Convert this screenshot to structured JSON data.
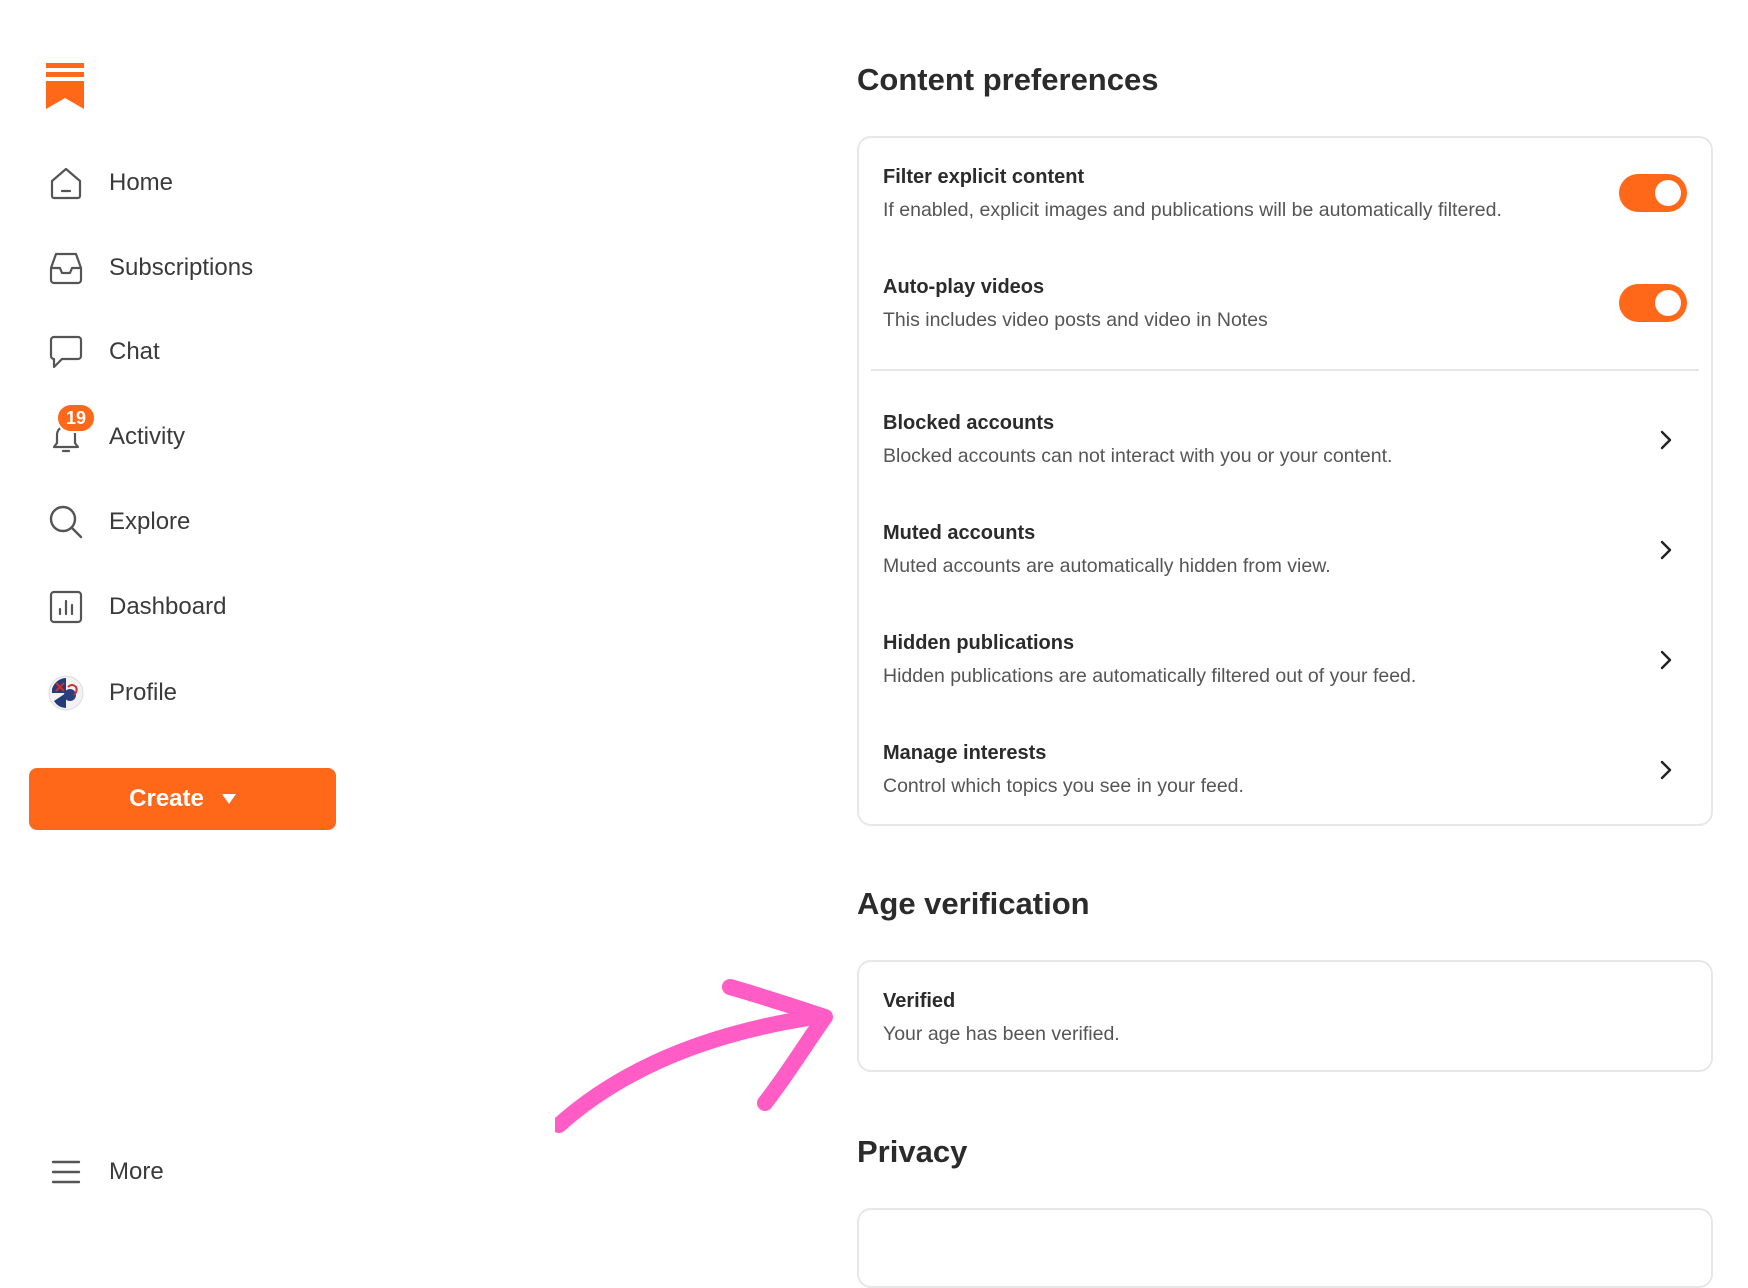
{
  "sidebar": {
    "items": [
      {
        "label": "Home",
        "icon": "home-icon"
      },
      {
        "label": "Subscriptions",
        "icon": "inbox-icon"
      },
      {
        "label": "Chat",
        "icon": "chat-bubble-icon"
      },
      {
        "label": "Activity",
        "icon": "bell-icon",
        "badge": "19"
      },
      {
        "label": "Explore",
        "icon": "search-icon"
      },
      {
        "label": "Dashboard",
        "icon": "bar-chart-icon"
      },
      {
        "label": "Profile",
        "icon": "avatar"
      }
    ],
    "create_label": "Create",
    "more_label": "More"
  },
  "content_preferences": {
    "title": "Content preferences",
    "toggles": [
      {
        "title": "Filter explicit content",
        "desc": "If enabled, explicit images and publications will be automatically filtered.",
        "on": true
      },
      {
        "title": "Auto-play videos",
        "desc": "This includes video posts and video in Notes",
        "on": true
      }
    ],
    "links": [
      {
        "title": "Blocked accounts",
        "desc": "Blocked accounts can not interact with you or your content."
      },
      {
        "title": "Muted accounts",
        "desc": "Muted accounts are automatically hidden from view."
      },
      {
        "title": "Hidden publications",
        "desc": "Hidden publications are automatically filtered out of your feed."
      },
      {
        "title": "Manage interests",
        "desc": "Control which topics you see in your feed."
      }
    ]
  },
  "age_verification": {
    "title": "Age verification",
    "status_title": "Verified",
    "status_desc": "Your age has been verified."
  },
  "privacy": {
    "title": "Privacy"
  },
  "colors": {
    "accent": "#ff6719",
    "annotation_arrow": "#ff5cc6"
  }
}
